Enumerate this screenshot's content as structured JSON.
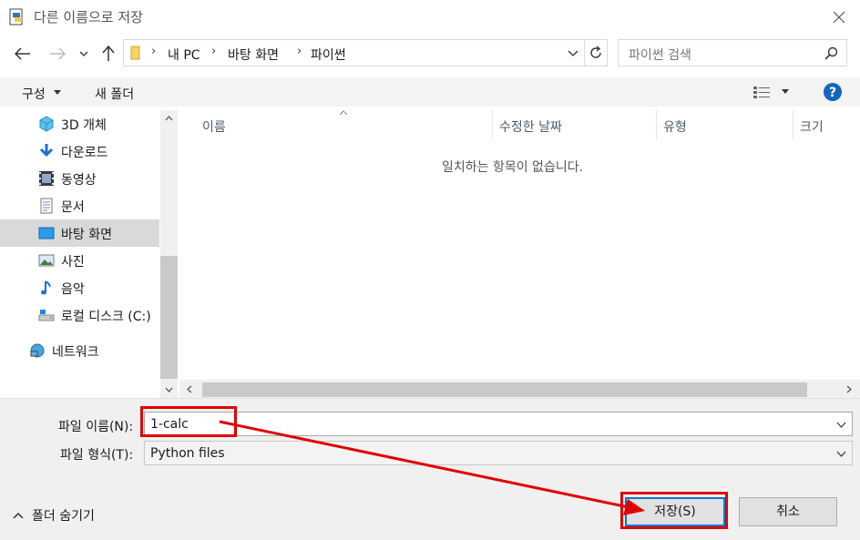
{
  "window": {
    "title": "다른 이름으로 저장"
  },
  "nav": {
    "breadcrumb": [
      "내 PC",
      "바탕 화면",
      "파이썬"
    ],
    "search_placeholder": "파이썬 검색"
  },
  "toolbar": {
    "organize": "구성",
    "new_folder": "새 폴더"
  },
  "sidebar": {
    "items": [
      {
        "label": "3D 개체",
        "icon": "3d-objects-icon"
      },
      {
        "label": "다운로드",
        "icon": "download-icon"
      },
      {
        "label": "동영상",
        "icon": "video-icon"
      },
      {
        "label": "문서",
        "icon": "document-icon"
      },
      {
        "label": "바탕 화면",
        "icon": "desktop-icon",
        "selected": true
      },
      {
        "label": "사진",
        "icon": "picture-icon"
      },
      {
        "label": "음악",
        "icon": "music-icon"
      },
      {
        "label": "로컬 디스크 (C:)",
        "icon": "disk-icon"
      }
    ],
    "network": {
      "label": "네트워크",
      "icon": "network-icon"
    }
  },
  "list": {
    "columns": [
      "이름",
      "수정한 날짜",
      "유형",
      "크기"
    ],
    "empty_message": "일치하는 항목이 없습니다."
  },
  "form": {
    "filename_label": "파일 이름(N):",
    "filename_value": "1-calc",
    "filetype_label": "파일 형식(T):",
    "filetype_value": "Python files"
  },
  "footer": {
    "hide_folders": "폴더 숨기기",
    "save": "저장(S)",
    "cancel": "취소"
  },
  "colors": {
    "annotation": "#e00000",
    "accent": "#0078d7"
  }
}
